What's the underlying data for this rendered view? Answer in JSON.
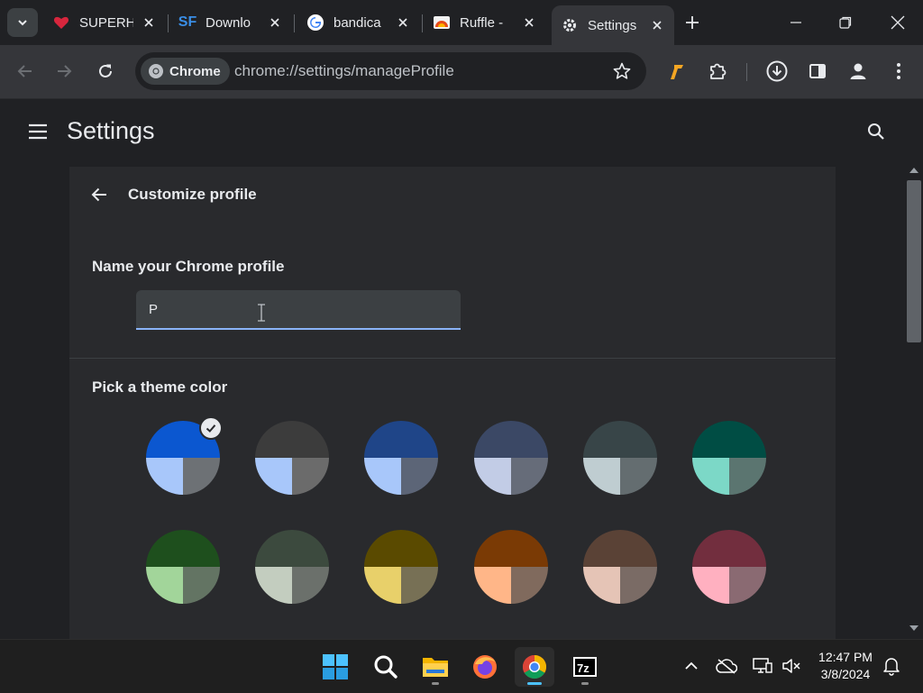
{
  "browser": {
    "tabs": [
      {
        "title": "SUPERH",
        "icon": "heart-icon",
        "active": false
      },
      {
        "title": "Downlo",
        "icon": "sourceforge-icon",
        "active": false
      },
      {
        "title": "bandica",
        "icon": "google-icon",
        "active": false
      },
      {
        "title": "Ruffle -",
        "icon": "ruffle-icon",
        "active": false
      },
      {
        "title": "Settings",
        "icon": "gear-icon",
        "active": true
      }
    ],
    "chip_label": "Chrome",
    "url": "chrome://settings/manageProfile"
  },
  "settings": {
    "title": "Settings",
    "card_title": "Customize profile",
    "name_label": "Name your Chrome profile",
    "name_value": "P",
    "theme_label": "Pick a theme color",
    "themes": [
      {
        "top": "#0b57d0",
        "bottom_left": "#a8c7fa",
        "bottom_right": "#6d7175",
        "selected": true
      },
      {
        "top": "#3c3c3c",
        "bottom_left": "#a8c7fa",
        "bottom_right": "#6b6b6b",
        "selected": false
      },
      {
        "top": "#1f4588",
        "bottom_left": "#a8c7fa",
        "bottom_right": "#5c6577",
        "selected": false
      },
      {
        "top": "#3b4865",
        "bottom_left": "#c2cce6",
        "bottom_right": "#666c79",
        "selected": false
      },
      {
        "top": "#384548",
        "bottom_left": "#bfcdd1",
        "bottom_right": "#646d70",
        "selected": false
      },
      {
        "top": "#004d44",
        "bottom_left": "#7cd8c7",
        "bottom_right": "#5b7570",
        "selected": false
      },
      {
        "top": "#1e4f1d",
        "bottom_left": "#a2d59a",
        "bottom_right": "#637463",
        "selected": false
      },
      {
        "top": "#3c4a3e",
        "bottom_left": "#c3cdbf",
        "bottom_right": "#6b706b",
        "selected": false
      },
      {
        "top": "#5a4a00",
        "bottom_left": "#e8d06a",
        "bottom_right": "#777055",
        "selected": false
      },
      {
        "top": "#7a3a05",
        "bottom_left": "#ffb688",
        "bottom_right": "#806a5d",
        "selected": false
      },
      {
        "top": "#5a4236",
        "bottom_left": "#e5c4b6",
        "bottom_right": "#7a6b65",
        "selected": false
      },
      {
        "top": "#722e3e",
        "bottom_left": "#ffb0c0",
        "bottom_right": "#8a6a72",
        "selected": false
      }
    ]
  },
  "taskbar": {
    "time": "12:47 PM",
    "date": "3/8/2024"
  }
}
